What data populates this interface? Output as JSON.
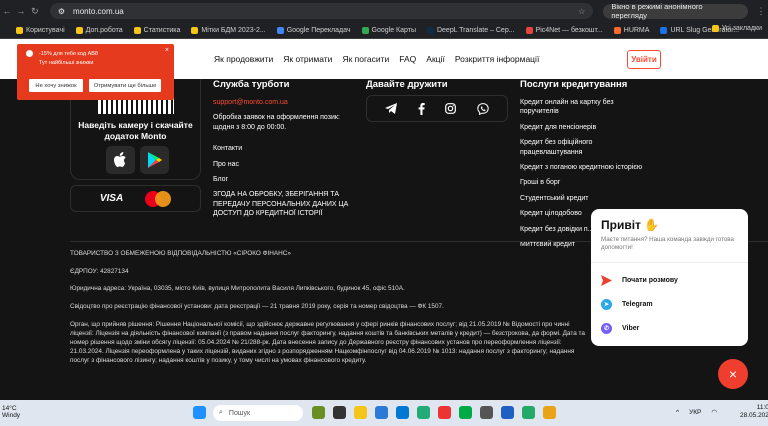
{
  "browser": {
    "url": "monto.com.ua",
    "incognito_label": "Вікно в режимі анонімного перегляду"
  },
  "bookmarks": {
    "items": [
      "Користувачі",
      "Доп.робота",
      "Статистика",
      "Мітки БДМ 2023-2...",
      "Google Перекладач",
      "Google Карты",
      "DeepL Translate – Cер...",
      "Pic4Net — безкошт...",
      "HURMA",
      "URL Slug Generator..."
    ],
    "other": "Усі закладки"
  },
  "header": {
    "menu": [
      "Як продовжити",
      "Як отримати",
      "Як погасити",
      "FAQ",
      "Акції",
      "Розкриття інформації"
    ],
    "login_label": "Увійти"
  },
  "notification": {
    "line1": "-15% для тебе код AB8",
    "line2": "Тут найбільші знижки",
    "close": "×",
    "decline_label": "Не хочу знижок",
    "accept_label": "Отримувати ще більше"
  },
  "app": {
    "scan_text": "Наведіть камеру і скачайте додаток Monto",
    "payments": {
      "visa": "VISA"
    }
  },
  "support": {
    "heading": "Служба турботи",
    "email": "support@monto.com.ua",
    "hours": "Обробка заявок на оформлення позик: щодня з 8:00 до 00:00.",
    "links": [
      "Контакти",
      "Про нас",
      "Блог"
    ],
    "consent": "ЗГОДА НА ОБРОБКУ, ЗБЕРІГАННЯ ТА ПЕРЕДАЧУ ПЕРСОНАЛЬНИХ ДАНИХ ЦА ДОСТУП ДО КРЕДИТНОЇ ІСТОРІЇ"
  },
  "friends": {
    "heading": "Давайте дружити",
    "icons": [
      "telegram-icon",
      "facebook-icon",
      "instagram-icon",
      "viber-icon"
    ]
  },
  "services": {
    "heading": "Послуги кредитування",
    "items": [
      "Кредит онлайн на картку без поручителів",
      "Кредит для пенсіонерів",
      "Кредит без офіційного працевлаштування",
      "Кредит з поганою кредитною історією",
      "Гроші в борг",
      "Студентський кредит",
      "Кредит цілодобово",
      "Кредит без довідки п...",
      "Миттєвий кредит"
    ]
  },
  "legal": {
    "company": "ТОВАРИСТВО З ОБМЕЖЕНОЮ ВІДПОВІДАЛЬНІСТЮ «СІРОКО ФІНАНС»",
    "edrpou": "ЄДРПОУ: 42827134",
    "address": "Юридична адреса: Україна, 03035, місто Київ, вулиця Митрополита Василя Липківського, будинок 45, офіс 510А.",
    "certificate": "Свідоцтво про реєстрацію фінансової установи: дата реєстрації — 21 травня 2019 року, серія та номер свідоцтва — ФК 1507.",
    "paragraph": "Орган, що прийняв рішення: Рішення Національної комісії, що здійснює державне регулювання у сфері ринків фінансових послуг; від 21.05.2019 № Відомості про чинні ліцензії: Ліцензія на діяльність фінансової компанії (з правом надання послуг факторингу, надання коштів та банківських металів у кредит) — безстрокова, да формі. Дата та номер рішення щодо зміни обсягу ліцензії: 05.04.2024 № 21/288-рк. Дата внесення запису до Державного реєстру фінансових установ про переоформлення ліцензії: 21.03.2024. Ліцензія переоформлена у таких ліцензій, виданих згідно з розпорядженням Нацкомфінпослуг від 04.06.2019 № 1013: надання послуг з факторингу; надання послуг з фінансового лізингу; надання коштів у позику, у тому числі на умовах фінансового кредиту."
  },
  "chat": {
    "title": "Привіт",
    "subtitle": "Маєте питання? Наша команда завжди готова допомогти!",
    "options": [
      "Почати розмову",
      "Telegram",
      "Viber"
    ],
    "close": "×"
  },
  "taskbar": {
    "temp": "14°C",
    "weather": "Windy",
    "search": "Пошук",
    "lang": "УКР",
    "time": "11:02",
    "date": "28.05.2026"
  },
  "colors": {
    "accent": "#ff4b33",
    "background": "#141414"
  }
}
